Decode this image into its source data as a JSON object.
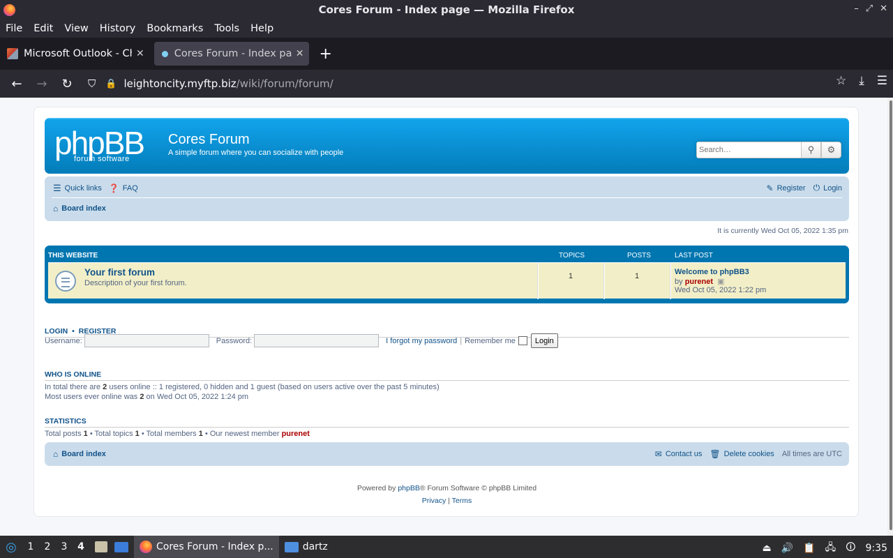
{
  "window": {
    "title": "Cores Forum - Index page — Mozilla Firefox",
    "controls": [
      "–",
      "⤢",
      "✕"
    ]
  },
  "menubar": [
    "File",
    "Edit",
    "View",
    "History",
    "Bookmarks",
    "Tools",
    "Help"
  ],
  "tabs": [
    {
      "label": "Microsoft Outlook - Chrome",
      "active": false
    },
    {
      "label": "Cores Forum - Index page",
      "active": true
    }
  ],
  "navbar": {
    "url_host": "leightoncity.myftp.biz",
    "url_path": "/wiki/forum/forum/"
  },
  "forum": {
    "logo_text": "phpBB",
    "logo_sub": "forum  software",
    "site_title": "Cores Forum",
    "site_desc": "A simple forum where you can socialize with people",
    "search_placeholder": "Search…",
    "quick_links": "Quick links",
    "faq": "FAQ",
    "register": "Register",
    "login": "Login",
    "board_index": "Board index",
    "current_time": "It is currently Wed Oct 05, 2022 1:35 pm",
    "table": {
      "headers": {
        "section": "THIS WEBSITE",
        "topics": "TOPICS",
        "posts": "POSTS",
        "last_post": "LAST POST"
      },
      "row": {
        "title": "Your first forum",
        "desc": "Description of your first forum.",
        "topics": "1",
        "posts": "1",
        "last_post_title": "Welcome to phpBB3",
        "last_post_by": "by",
        "last_post_user": "purenet",
        "last_post_date": "Wed Oct 05, 2022 1:22 pm"
      }
    },
    "login_section": {
      "title_login": "LOGIN",
      "bullet": "•",
      "title_register": "REGISTER",
      "username_label": "Username:",
      "password_label": "Password:",
      "forgot": "I forgot my password",
      "pipe": "|",
      "remember": "Remember me",
      "button": "Login"
    },
    "who_online": {
      "title": "WHO IS ONLINE",
      "line1_pre": "In total there are",
      "line1_count": "2",
      "line1_post": "users online :: 1 registered, 0 hidden and 1 guest (based on users active over the past 5 minutes)",
      "line2_pre": "Most users ever online was",
      "line2_count": "2",
      "line2_post": "on Wed Oct 05, 2022 1:24 pm"
    },
    "statistics": {
      "title": "STATISTICS",
      "posts_label": "Total posts",
      "posts": "1",
      "topics_label": "• Total topics",
      "topics": "1",
      "members_label": "• Total members",
      "members": "1",
      "newest_label": "• Our newest member",
      "newest": "purenet"
    },
    "footer": {
      "board_index": "Board index",
      "contact": "Contact us",
      "delete_cookies": "Delete cookies",
      "timezone": "All times are UTC",
      "powered_pre": "Powered by",
      "powered_link": "phpBB",
      "powered_post": "® Forum Software © phpBB Limited",
      "privacy": "Privacy",
      "pipe": "|",
      "terms": "Terms"
    }
  },
  "taskbar": {
    "workspaces": [
      "1",
      "2",
      "3",
      "4"
    ],
    "current_workspace": "4",
    "apps": [
      {
        "label": "Cores Forum - Index p...",
        "active": true
      },
      {
        "label": "dartz",
        "active": false
      }
    ],
    "clock": "9:35"
  }
}
